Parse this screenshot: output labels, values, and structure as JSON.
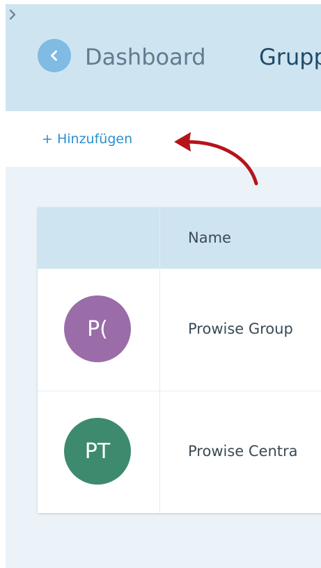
{
  "header": {
    "breadcrumb": {
      "dashboard": "Dashboard",
      "current": "Grupp"
    }
  },
  "toolbar": {
    "add_label": "+ Hinzufügen"
  },
  "table": {
    "columns": [
      "",
      "Name"
    ],
    "rows": [
      {
        "initials": "P(",
        "name": "Prowise Group",
        "avatar_color": "#9a6da8"
      },
      {
        "initials": "PT",
        "name": "Prowise Centra",
        "avatar_color": "#3d8a6e"
      }
    ]
  },
  "colors": {
    "accent": "#2a8fd0",
    "header_bg": "#cfe4f1",
    "annotation_arrow": "#b5141b"
  }
}
